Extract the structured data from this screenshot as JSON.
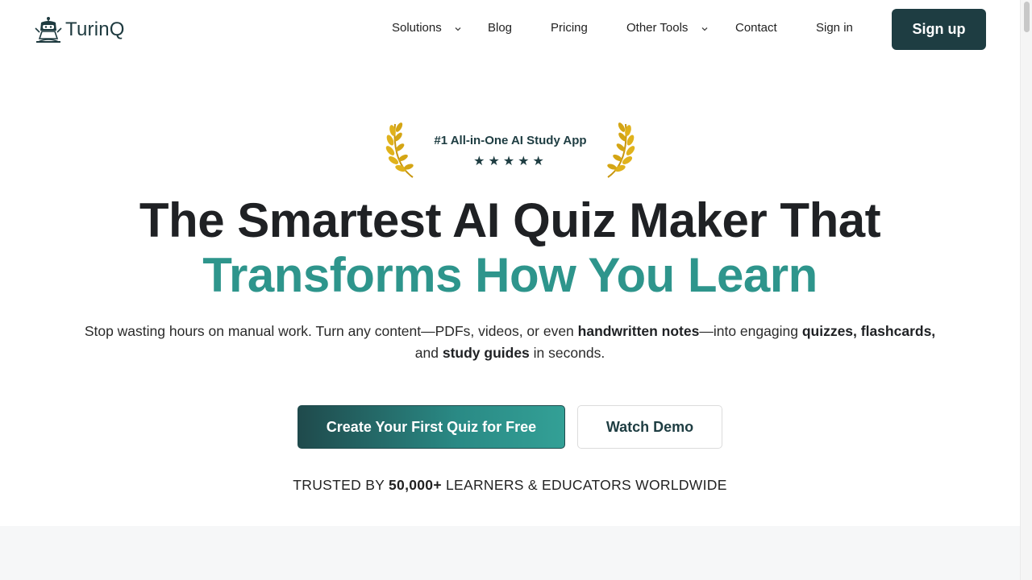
{
  "brand": {
    "name": "TurinQ",
    "logo_icon": "robot-icon"
  },
  "nav": {
    "solutions": "Solutions",
    "blog": "Blog",
    "pricing": "Pricing",
    "other_tools": "Other Tools",
    "contact": "Contact",
    "sign_in": "Sign in",
    "sign_up": "Sign up"
  },
  "award": {
    "text": "#1 All-in-One AI Study App",
    "stars": "★★★★★",
    "rating": 5
  },
  "hero": {
    "headline_line1": "The Smartest AI Quiz Maker That",
    "headline_line2": "Transforms How You Learn",
    "sub_part1": "Stop wasting hours on manual work. Turn any content—PDFs, videos, or even ",
    "sub_bold1": "handwritten notes",
    "sub_part2": "—into engaging ",
    "sub_bold2": "quizzes, flashcards,",
    "sub_part3": " and ",
    "sub_bold3": "study guides",
    "sub_part4": " in seconds."
  },
  "cta": {
    "primary": "Create Your First Quiz for Free",
    "secondary": "Watch Demo"
  },
  "trust": {
    "prefix": "TRUSTED BY ",
    "count": "50,000+",
    "suffix": " LEARNERS & EDUCATORS WORLDWIDE"
  },
  "colors": {
    "accent_dark": "#1e3d42",
    "accent_teal": "#2e958c",
    "laurel_gold": "#d4a514"
  }
}
